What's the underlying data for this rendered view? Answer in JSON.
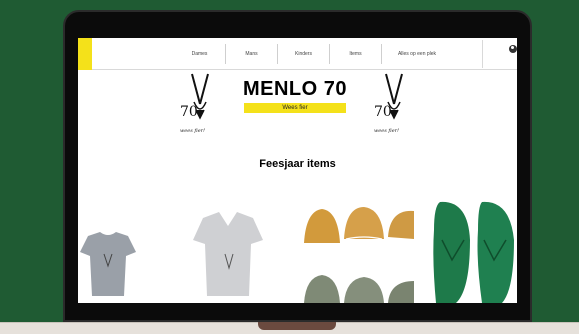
{
  "nav": {
    "items": [
      "Dames",
      "Mans",
      "Kinders",
      "Items",
      "Alles op een plek"
    ]
  },
  "header": {
    "title": "MENLO 70",
    "motto": "Wees fier",
    "logo_text": "wees fier!"
  },
  "main": {
    "section_title": "Feesjaar items"
  },
  "colors": {
    "accent": "#f4e11a",
    "background": "#1f5b33"
  }
}
